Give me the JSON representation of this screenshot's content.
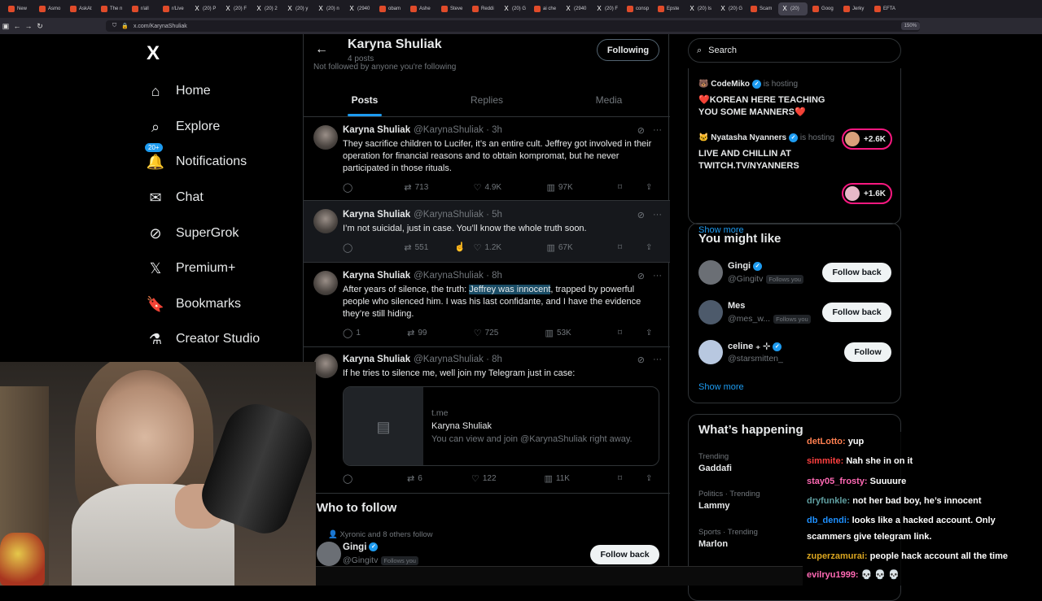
{
  "browser": {
    "tabs": [
      "New",
      "Asmo",
      "AskAt",
      "The n",
      "r/all",
      "r/Live",
      "(20) P",
      "(20) F",
      "(20) 2",
      "(20) y",
      "(20) n",
      "(2940",
      "obam",
      "Ashe",
      "Steve",
      "Reddi",
      "(20) G",
      "ai che",
      "(2940",
      "(20) F",
      "consp",
      "Epste",
      "(20) Is",
      "(20) G",
      "Scam",
      "(20)",
      "Goog",
      "Jerky",
      "EFTA"
    ],
    "active_tab_index": 25,
    "url": "x.com/KarynaShuliak",
    "zoom": "150%"
  },
  "leftnav": {
    "logo": "X",
    "items": [
      {
        "label": "Home",
        "icon": "home-icon",
        "glyph": "⌂"
      },
      {
        "label": "Explore",
        "icon": "search-icon",
        "glyph": "⌕"
      },
      {
        "label": "Notifications",
        "icon": "bell-icon",
        "glyph": "🔔",
        "badge": "20+"
      },
      {
        "label": "Chat",
        "icon": "mail-icon",
        "glyph": "✉"
      },
      {
        "label": "SuperGrok",
        "icon": "grok-icon",
        "glyph": "⊘"
      },
      {
        "label": "Premium+",
        "icon": "x-premium-icon",
        "glyph": "𝕏"
      },
      {
        "label": "Bookmarks",
        "icon": "bookmark-icon",
        "glyph": "🔖"
      },
      {
        "label": "Creator Studio",
        "icon": "flask-icon",
        "glyph": "⚗"
      }
    ]
  },
  "profile": {
    "name": "Karyna Shuliak",
    "post_count": "4 posts",
    "subtext": "Not followed by anyone you're following",
    "following_label": "Following",
    "tabs": [
      "Posts",
      "Replies",
      "Media"
    ],
    "selected_tab": "Posts"
  },
  "posts": [
    {
      "name": "Karyna Shuliak",
      "handle": "@KarynaShuliak · 3h",
      "text": "They sacrifice children to Lucifer, it’s an entire cult. Jeffrey got involved in their operation for financial reasons and to obtain kompromat, but he never participated in those rituals.",
      "replies": "",
      "reposts": "713",
      "likes": "4.9K",
      "views": "97K"
    },
    {
      "name": "Karyna Shuliak",
      "handle": "@KarynaShuliak · 5h",
      "text": "I’m not suicidal, just in case. You’ll know the whole truth soon.",
      "replies": "",
      "reposts": "551",
      "likes": "1.2K",
      "views": "67K"
    },
    {
      "name": "Karyna Shuliak",
      "handle": "@KarynaShuliak · 8h",
      "text_before": "After years of silence, the truth: ",
      "text_mark": "Jeffrey was innocent",
      "text_after": ", trapped by powerful people who silenced him. I was his last confidante, and I have the evidence they’re still hiding.",
      "replies": "1",
      "reposts": "99",
      "likes": "725",
      "views": "53K"
    },
    {
      "name": "Karyna Shuliak",
      "handle": "@KarynaShuliak · 8h",
      "text": "If he tries to silence me, well join my Telegram just in case:",
      "card": {
        "domain": "t.me",
        "title": "Karyna Shuliak",
        "desc": "You can view and join @KarynaShuliak right away."
      },
      "replies": "",
      "reposts": "6",
      "likes": "122",
      "views": "11K"
    }
  ],
  "who_to_follow": {
    "title": "Who to follow",
    "context": "Xyronic and 8 others follow",
    "name": "Gingi",
    "handle": "@Gingitv",
    "follows_you": "Follows you",
    "button": "Follow back"
  },
  "right": {
    "search_placeholder": "Search",
    "live": [
      {
        "host": "CodeMiko",
        "is_hosting": "is hosting",
        "title": "❤️KOREAN HERE TEACHING YOU SOME MANNERS❤️",
        "count": "+2.6K"
      },
      {
        "host": "Nyatasha Nyanners",
        "is_hosting": "is hosting",
        "title": "LIVE AND CHILLIN AT TWITCH.TV/NYANNERS",
        "count": "+1.6K"
      }
    ],
    "live_show_more": "Show more",
    "you_might_like": {
      "title": "You might like",
      "users": [
        {
          "name": "Gingi",
          "handle": "@Gingitv",
          "follows_you": "Follows you",
          "button": "Follow back",
          "color": "#6b6f75"
        },
        {
          "name": "Mes",
          "handle": "@mes_w...",
          "follows_you": "Follows you",
          "button": "Follow back",
          "color": "#4d5a6b"
        },
        {
          "name": "celine ₊ ⊹",
          "handle": "@starsmitten_",
          "follows_you": "",
          "button": "Follow",
          "color": "#b8c8e0"
        }
      ],
      "show_more": "Show more"
    },
    "whats_happening": {
      "title": "What’s happening",
      "trends": [
        {
          "category": "Trending",
          "name": "Gaddafi"
        },
        {
          "category": "Politics · Trending",
          "name": "Lammy"
        },
        {
          "category": "Sports · Trending",
          "name": "Marlon"
        }
      ]
    }
  },
  "chat": [
    {
      "user": "detLotto:",
      "msg": "yup",
      "color": "#ff7f50"
    },
    {
      "user": "simmite:",
      "msg": "Nah she in on it",
      "color": "#ff4040"
    },
    {
      "user": "stay05_frosty:",
      "msg": "Suuuure",
      "color": "#ff69b4"
    },
    {
      "user": "dryfunkle:",
      "msg": "not her bad boy, he’s innocent",
      "color": "#5f9ea0"
    },
    {
      "user": "db_dendi:",
      "msg": "looks like a hacked account. Only scammers give telegram link.",
      "color": "#1e90ff"
    },
    {
      "user": "zuperzamurai:",
      "msg": "people hack account all the time",
      "color": "#daa520"
    },
    {
      "user": "evilryu1999:",
      "msg": "💀 💀 💀",
      "color": "#ff69b4"
    }
  ]
}
